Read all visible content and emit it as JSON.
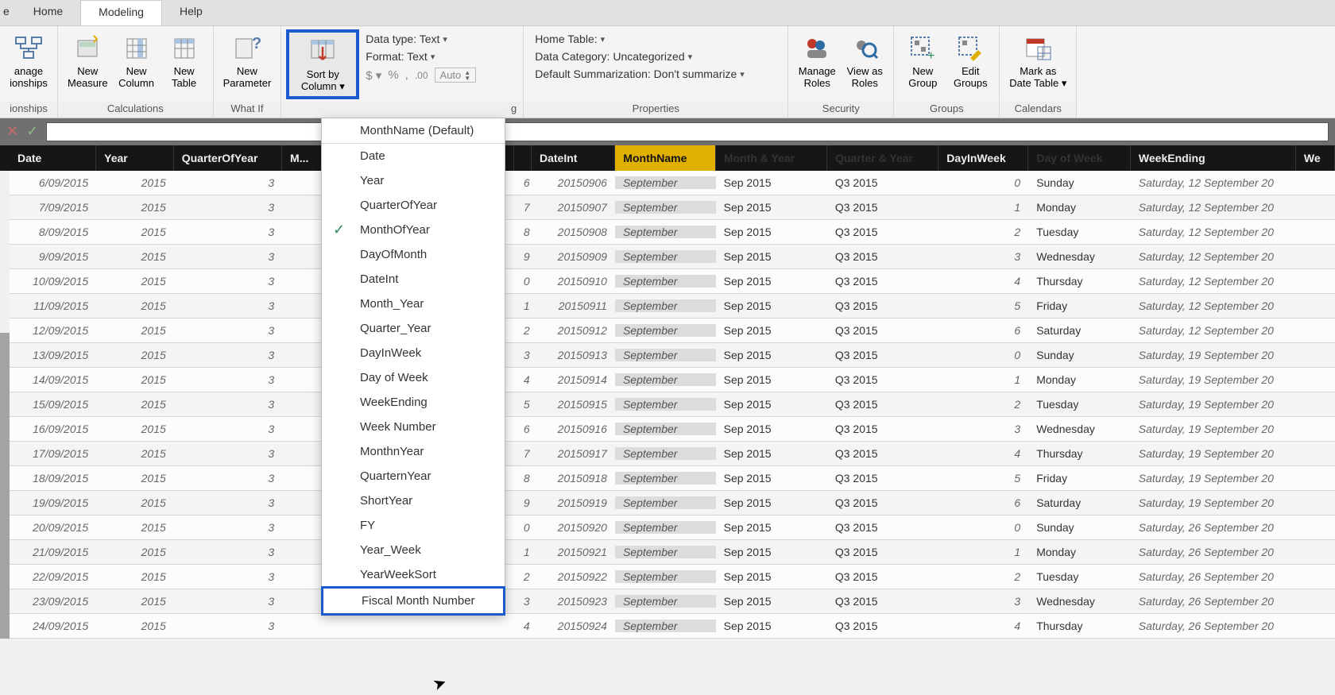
{
  "tabs": {
    "partial": "e",
    "home": "Home",
    "modeling": "Modeling",
    "help": "Help"
  },
  "ribbon": {
    "relationships": {
      "manage_l1": "anage",
      "manage_l2": "ionships",
      "group_label": "ionships"
    },
    "calculations": {
      "new_measure_l1": "New",
      "new_measure_l2": "Measure",
      "new_column_l1": "New",
      "new_column_l2": "Column",
      "new_table_l1": "New",
      "new_table_l2": "Table",
      "group_label": "Calculations"
    },
    "whatif": {
      "new_param_l1": "New",
      "new_param_l2": "Parameter",
      "group_label": "What If"
    },
    "sort": {
      "sort_l1": "Sort by",
      "sort_l2": "Column"
    },
    "formatting": {
      "data_type": "Data type: Text",
      "format": "Format: Text",
      "currency": "$",
      "percent": "%",
      "comma": ",",
      "decimals": ".00",
      "auto": "Auto",
      "group_label_tail": "g"
    },
    "properties": {
      "home_table": "Home Table:",
      "data_category": "Data Category: Uncategorized",
      "summarization": "Default Summarization: Don't summarize",
      "group_label": "Properties"
    },
    "security": {
      "manage_roles_l1": "Manage",
      "manage_roles_l2": "Roles",
      "view_as_l1": "View as",
      "view_as_l2": "Roles",
      "group_label": "Security"
    },
    "groups": {
      "new_group_l1": "New",
      "new_group_l2": "Group",
      "edit_groups_l1": "Edit",
      "edit_groups_l2": "Groups",
      "group_label": "Groups"
    },
    "calendars": {
      "mark_l1": "Mark as",
      "mark_l2": "Date Table",
      "group_label": "Calendars"
    }
  },
  "dropdown": {
    "default_label": "MonthName (Default)",
    "items": [
      {
        "label": "Date",
        "checked": false
      },
      {
        "label": "Year",
        "checked": false
      },
      {
        "label": "QuarterOfYear",
        "checked": false
      },
      {
        "label": "MonthOfYear",
        "checked": true
      },
      {
        "label": "DayOfMonth",
        "checked": false
      },
      {
        "label": "DateInt",
        "checked": false
      },
      {
        "label": "Month_Year",
        "checked": false
      },
      {
        "label": "Quarter_Year",
        "checked": false
      },
      {
        "label": "DayInWeek",
        "checked": false
      },
      {
        "label": "Day of Week",
        "checked": false
      },
      {
        "label": "WeekEnding",
        "checked": false
      },
      {
        "label": "Week Number",
        "checked": false
      },
      {
        "label": "MonthnYear",
        "checked": false
      },
      {
        "label": "QuarternYear",
        "checked": false
      },
      {
        "label": "ShortYear",
        "checked": false
      },
      {
        "label": "FY",
        "checked": false
      },
      {
        "label": "Year_Week",
        "checked": false
      },
      {
        "label": "YearWeekSort",
        "checked": false
      },
      {
        "label": "Fiscal Month Number",
        "checked": false,
        "highlighted": true
      }
    ]
  },
  "grid": {
    "columns": {
      "date": "Date",
      "year": "Year",
      "qoy": "QuarterOfYear",
      "moy": "M...",
      "dint": "DateInt",
      "mname": "MonthName",
      "myear": "Month & Year",
      "qyear": "Quarter & Year",
      "diw": "DayInWeek",
      "dow": "Day of Week",
      "wend": "WeekEnding",
      "wk": "We"
    },
    "rows": [
      {
        "date": "6/09/2015",
        "year": "2015",
        "qoy": "3",
        "tail": "6",
        "dint": "20150906",
        "mname": "September",
        "myear": "Sep 2015",
        "qyear": "Q3 2015",
        "diw": "0",
        "dow": "Sunday",
        "wend": "Saturday, 12 September 20"
      },
      {
        "date": "7/09/2015",
        "year": "2015",
        "qoy": "3",
        "tail": "7",
        "dint": "20150907",
        "mname": "September",
        "myear": "Sep 2015",
        "qyear": "Q3 2015",
        "diw": "1",
        "dow": "Monday",
        "wend": "Saturday, 12 September 20"
      },
      {
        "date": "8/09/2015",
        "year": "2015",
        "qoy": "3",
        "tail": "8",
        "dint": "20150908",
        "mname": "September",
        "myear": "Sep 2015",
        "qyear": "Q3 2015",
        "diw": "2",
        "dow": "Tuesday",
        "wend": "Saturday, 12 September 20"
      },
      {
        "date": "9/09/2015",
        "year": "2015",
        "qoy": "3",
        "tail": "9",
        "dint": "20150909",
        "mname": "September",
        "myear": "Sep 2015",
        "qyear": "Q3 2015",
        "diw": "3",
        "dow": "Wednesday",
        "wend": "Saturday, 12 September 20"
      },
      {
        "date": "10/09/2015",
        "year": "2015",
        "qoy": "3",
        "tail": "0",
        "dint": "20150910",
        "mname": "September",
        "myear": "Sep 2015",
        "qyear": "Q3 2015",
        "diw": "4",
        "dow": "Thursday",
        "wend": "Saturday, 12 September 20"
      },
      {
        "date": "11/09/2015",
        "year": "2015",
        "qoy": "3",
        "tail": "1",
        "dint": "20150911",
        "mname": "September",
        "myear": "Sep 2015",
        "qyear": "Q3 2015",
        "diw": "5",
        "dow": "Friday",
        "wend": "Saturday, 12 September 20"
      },
      {
        "date": "12/09/2015",
        "year": "2015",
        "qoy": "3",
        "tail": "2",
        "dint": "20150912",
        "mname": "September",
        "myear": "Sep 2015",
        "qyear": "Q3 2015",
        "diw": "6",
        "dow": "Saturday",
        "wend": "Saturday, 12 September 20"
      },
      {
        "date": "13/09/2015",
        "year": "2015",
        "qoy": "3",
        "tail": "3",
        "dint": "20150913",
        "mname": "September",
        "myear": "Sep 2015",
        "qyear": "Q3 2015",
        "diw": "0",
        "dow": "Sunday",
        "wend": "Saturday, 19 September 20"
      },
      {
        "date": "14/09/2015",
        "year": "2015",
        "qoy": "3",
        "tail": "4",
        "dint": "20150914",
        "mname": "September",
        "myear": "Sep 2015",
        "qyear": "Q3 2015",
        "diw": "1",
        "dow": "Monday",
        "wend": "Saturday, 19 September 20"
      },
      {
        "date": "15/09/2015",
        "year": "2015",
        "qoy": "3",
        "tail": "5",
        "dint": "20150915",
        "mname": "September",
        "myear": "Sep 2015",
        "qyear": "Q3 2015",
        "diw": "2",
        "dow": "Tuesday",
        "wend": "Saturday, 19 September 20"
      },
      {
        "date": "16/09/2015",
        "year": "2015",
        "qoy": "3",
        "tail": "6",
        "dint": "20150916",
        "mname": "September",
        "myear": "Sep 2015",
        "qyear": "Q3 2015",
        "diw": "3",
        "dow": "Wednesday",
        "wend": "Saturday, 19 September 20"
      },
      {
        "date": "17/09/2015",
        "year": "2015",
        "qoy": "3",
        "tail": "7",
        "dint": "20150917",
        "mname": "September",
        "myear": "Sep 2015",
        "qyear": "Q3 2015",
        "diw": "4",
        "dow": "Thursday",
        "wend": "Saturday, 19 September 20"
      },
      {
        "date": "18/09/2015",
        "year": "2015",
        "qoy": "3",
        "tail": "8",
        "dint": "20150918",
        "mname": "September",
        "myear": "Sep 2015",
        "qyear": "Q3 2015",
        "diw": "5",
        "dow": "Friday",
        "wend": "Saturday, 19 September 20"
      },
      {
        "date": "19/09/2015",
        "year": "2015",
        "qoy": "3",
        "tail": "9",
        "dint": "20150919",
        "mname": "September",
        "myear": "Sep 2015",
        "qyear": "Q3 2015",
        "diw": "6",
        "dow": "Saturday",
        "wend": "Saturday, 19 September 20"
      },
      {
        "date": "20/09/2015",
        "year": "2015",
        "qoy": "3",
        "tail": "0",
        "dint": "20150920",
        "mname": "September",
        "myear": "Sep 2015",
        "qyear": "Q3 2015",
        "diw": "0",
        "dow": "Sunday",
        "wend": "Saturday, 26 September 20"
      },
      {
        "date": "21/09/2015",
        "year": "2015",
        "qoy": "3",
        "tail": "1",
        "dint": "20150921",
        "mname": "September",
        "myear": "Sep 2015",
        "qyear": "Q3 2015",
        "diw": "1",
        "dow": "Monday",
        "wend": "Saturday, 26 September 20"
      },
      {
        "date": "22/09/2015",
        "year": "2015",
        "qoy": "3",
        "tail": "2",
        "dint": "20150922",
        "mname": "September",
        "myear": "Sep 2015",
        "qyear": "Q3 2015",
        "diw": "2",
        "dow": "Tuesday",
        "wend": "Saturday, 26 September 20"
      },
      {
        "date": "23/09/2015",
        "year": "2015",
        "qoy": "3",
        "tail": "3",
        "dint": "20150923",
        "mname": "September",
        "myear": "Sep 2015",
        "qyear": "Q3 2015",
        "diw": "3",
        "dow": "Wednesday",
        "wend": "Saturday, 26 September 20"
      },
      {
        "date": "24/09/2015",
        "year": "2015",
        "qoy": "3",
        "tail": "4",
        "dint": "20150924",
        "mname": "September",
        "myear": "Sep 2015",
        "qyear": "Q3 2015",
        "diw": "4",
        "dow": "Thursday",
        "wend": "Saturday, 26 September 20"
      }
    ]
  }
}
